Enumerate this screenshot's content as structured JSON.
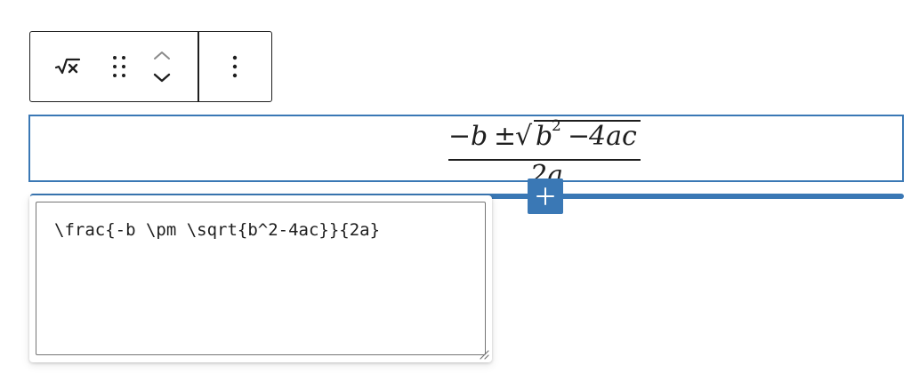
{
  "toolbar": {
    "block_type_icon": "square-root-x-icon",
    "drag_icon": "drag-handle-icon",
    "move_up_icon": "chevron-up-icon",
    "move_down_icon": "chevron-down-icon",
    "options_icon": "vertical-ellipsis-icon"
  },
  "math_block": {
    "numerator": {
      "minus": "−",
      "b": "b",
      "pm": "±",
      "sqrt_sign": "√",
      "radicand_b": "b",
      "exponent": "2",
      "radicand_rest_minus": "−",
      "radicand_rest_term": "4ac"
    },
    "denominator": "2a"
  },
  "inserter": {
    "icon": "plus-icon",
    "label": "+"
  },
  "latex_editor": {
    "value": "\\frac{-b \\pm \\sqrt{b^2-4ac}}{2a}",
    "resize_icon": "resize-handle-icon"
  },
  "colors": {
    "accent": "#3a78b5",
    "text": "#1e1e1e",
    "input_border": "#757575"
  }
}
